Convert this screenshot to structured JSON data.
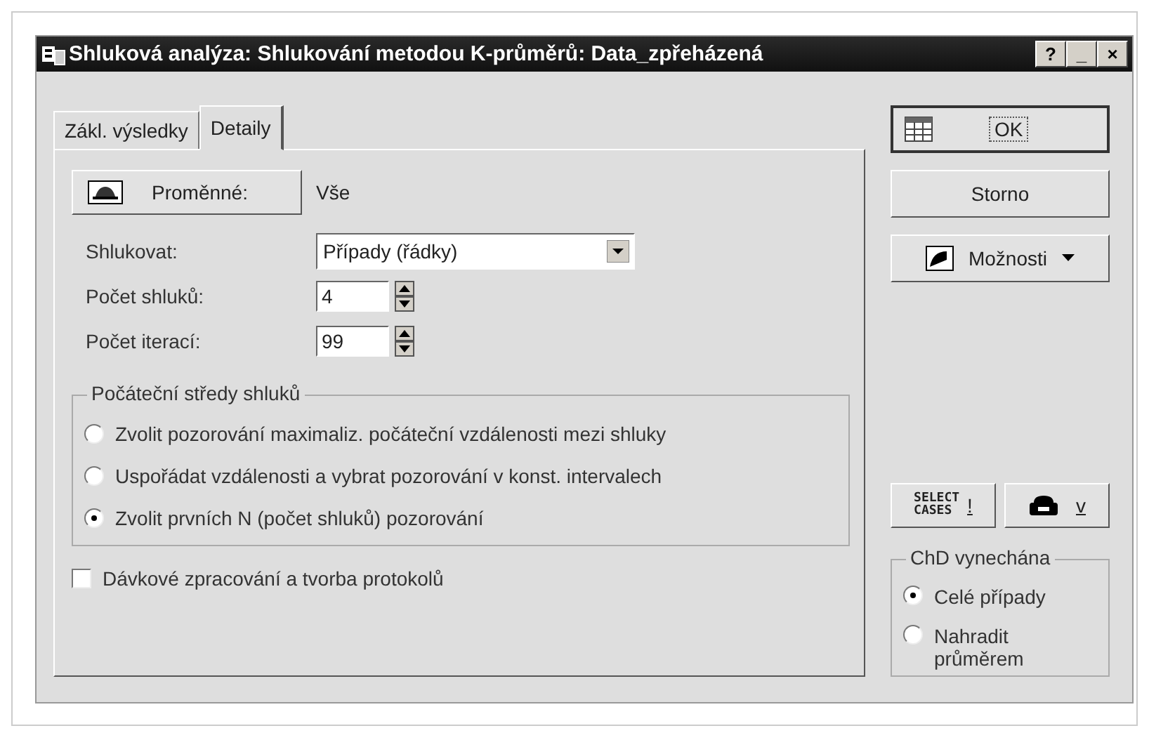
{
  "window": {
    "title": "Shluková analýza: Shlukování metodou K-průměrů: Data_zpřeházená",
    "title_buttons": [
      "?",
      "_",
      "×"
    ]
  },
  "tabs": [
    {
      "label": "Zákl. výsledky",
      "selected": false
    },
    {
      "label": "Detaily",
      "selected": true
    }
  ],
  "variables": {
    "button": "Proměnné:",
    "value": "Vše"
  },
  "fields": [
    {
      "kind": "dropdown",
      "label": "Shlukovat:",
      "value": "Případy (řádky)"
    },
    {
      "kind": "spinner",
      "label": "Počet shluků:",
      "value": "4"
    },
    {
      "kind": "spinner",
      "label": "Počet iterací:",
      "value": "99"
    }
  ],
  "initial_centers": {
    "title": "Počáteční středy shluků",
    "options": [
      {
        "label": "Zvolit pozorování maximaliz. počáteční vzdálenosti mezi shluky",
        "selected": false
      },
      {
        "label": "Uspořádat vzdálenosti a vybrat pozorování v konst. intervalech",
        "selected": false
      },
      {
        "label": "Zvolit prvních N (počet shluků) pozorování",
        "selected": true
      }
    ]
  },
  "batch": {
    "label": "Dávkové zpracování a tvorba protokolů",
    "checked": false
  },
  "buttons": {
    "ok": "OK",
    "cancel": "Storno",
    "options": "Možnosti"
  },
  "select_cases": {
    "label": "SELECT CASES",
    "key": "!"
  },
  "print": {
    "key": "v"
  },
  "missing": {
    "title": "ChD vynechána",
    "options": [
      {
        "label": "Celé případy",
        "selected": true
      },
      {
        "label": "Nahradit průměrem",
        "selected": false
      }
    ]
  }
}
